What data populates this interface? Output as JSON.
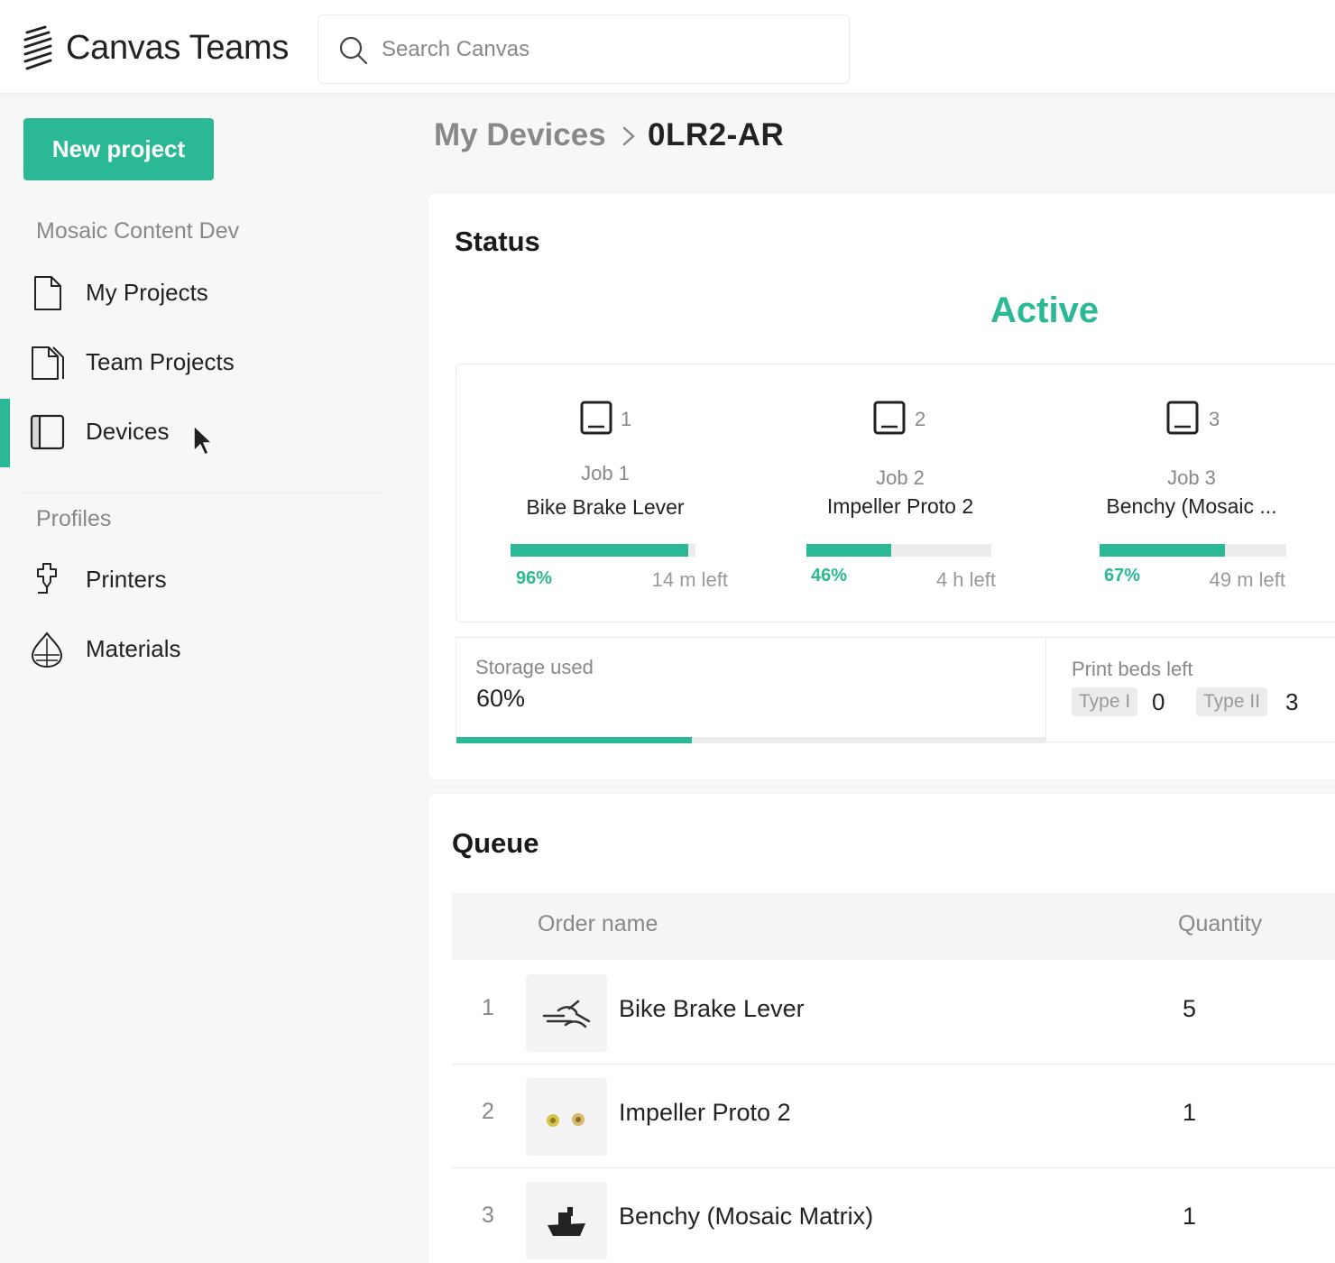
{
  "header": {
    "app_title": "Canvas Teams",
    "search_placeholder": "Search Canvas"
  },
  "sidebar": {
    "new_project_label": "New project",
    "workspace_label": "Mosaic Content Dev",
    "workspace_items": [
      {
        "label": "My Projects",
        "icon": "file-icon"
      },
      {
        "label": "Team Projects",
        "icon": "files-icon"
      },
      {
        "label": "Devices",
        "icon": "device-icon",
        "active": true
      }
    ],
    "profiles_label": "Profiles",
    "profile_items": [
      {
        "label": "Printers",
        "icon": "printer-nozzle-icon"
      },
      {
        "label": "Materials",
        "icon": "material-drop-icon"
      }
    ]
  },
  "breadcrumb": {
    "parent": "My Devices",
    "current": "0LR2-AR"
  },
  "status": {
    "title": "Status",
    "state": "Active",
    "jobs": [
      {
        "bed": "1",
        "job_label": "Job 1",
        "name": "Bike Brake Lever",
        "progress_label": "96%",
        "progress": 0.96,
        "time_left": "14 m left"
      },
      {
        "bed": "2",
        "job_label": "Job 2",
        "name": "Impeller Proto 2",
        "progress_label": "46%",
        "progress": 0.46,
        "time_left": "4 h left"
      },
      {
        "bed": "3",
        "job_label": "Job 3",
        "name": "Benchy (Mosaic ...",
        "progress_label": "67%",
        "progress": 0.67,
        "time_left": "49 m left"
      }
    ],
    "storage": {
      "label": "Storage used",
      "value": "60%",
      "fraction": 0.4
    },
    "print_beds": {
      "label": "Print beds left",
      "types": [
        {
          "type": "Type I",
          "count": "0"
        },
        {
          "type": "Type II",
          "count": "3"
        }
      ]
    }
  },
  "queue": {
    "title": "Queue",
    "columns": [
      "Order name",
      "Quantity"
    ],
    "rows": [
      {
        "index": "1",
        "name": "Bike Brake Lever",
        "quantity": "5"
      },
      {
        "index": "2",
        "name": "Impeller Proto 2",
        "quantity": "1"
      },
      {
        "index": "3",
        "name": "Benchy (Mosaic Matrix)",
        "quantity": "1"
      }
    ]
  },
  "colors": {
    "accent": "#2bb894",
    "muted_text": "#888888",
    "track": "#ececec"
  }
}
